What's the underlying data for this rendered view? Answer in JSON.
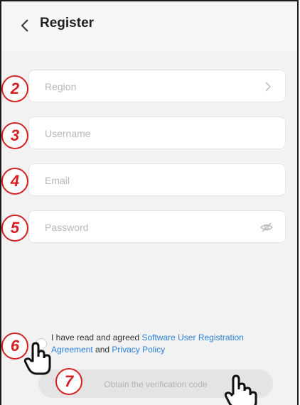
{
  "header": {
    "title": "Register"
  },
  "fields": {
    "region": {
      "placeholder": "Region",
      "step": "2"
    },
    "username": {
      "placeholder": "Username",
      "step": "3"
    },
    "email": {
      "placeholder": "Email",
      "step": "4"
    },
    "password": {
      "placeholder": "Password",
      "step": "5"
    }
  },
  "agreement": {
    "prefix": "I have read and agreed",
    "link1": "Software User Registration Agreement",
    "middle": "and",
    "link2": "Privacy Policy",
    "step": "6"
  },
  "verify": {
    "label": "Obtain the verification code",
    "step": "7"
  },
  "colors": {
    "step_badge": "#d32020",
    "link": "#2b7fd8",
    "background": "#f2f2f2"
  },
  "icons": [
    "chevron-left-icon",
    "chevron-right-icon",
    "eye-hidden-icon",
    "pointer-hand-icon"
  ]
}
